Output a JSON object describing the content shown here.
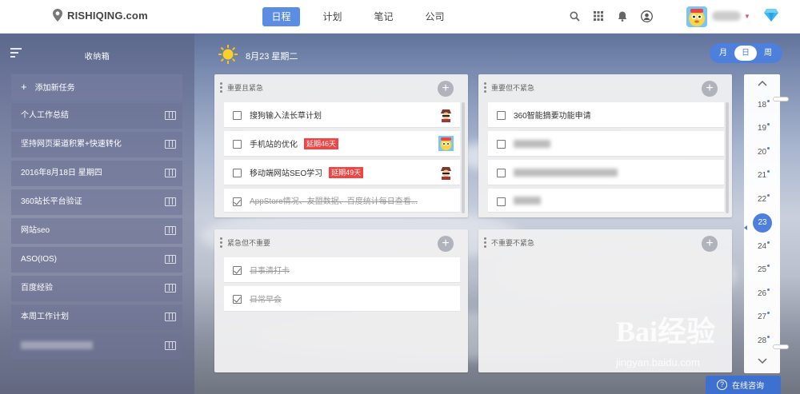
{
  "logo": {
    "text": "RISHIQING.com"
  },
  "nav": [
    {
      "label": "日程",
      "active": true
    },
    {
      "label": "计划",
      "active": false
    },
    {
      "label": "笔记",
      "active": false
    },
    {
      "label": "公司",
      "active": false
    }
  ],
  "top_icons": [
    "search-icon",
    "grid-icon",
    "bell-icon",
    "user-circle-icon"
  ],
  "sidebar": {
    "title": "收纳箱",
    "add_label": "添加新任务",
    "items": [
      "个人工作总结",
      "坚持网页渠道积累+快速转化",
      "2016年8月18日 星期四",
      "360站长平台验证",
      "网站seo",
      "ASO(IOS)",
      "百度经验",
      "本周工作计划",
      ""
    ]
  },
  "date_header": {
    "label": "8月23 星期二"
  },
  "view_switch": [
    {
      "label": "月",
      "active": false
    },
    {
      "label": "日",
      "active": true
    },
    {
      "label": "周",
      "active": false
    }
  ],
  "quadrants": {
    "q1": {
      "title": "重要且紧急",
      "tasks": [
        {
          "text": "搜狗输入法长草计划",
          "badge": "",
          "done": false
        },
        {
          "text": "手机站的优化",
          "badge": "延期46天",
          "done": false
        },
        {
          "text": "移动端网站SEO学习",
          "badge": "延期49天",
          "done": false
        },
        {
          "text": "AppStore情况、友盟数据、百度统计每日查看...",
          "badge": "",
          "done": true
        }
      ]
    },
    "q2": {
      "title": "重要但不紧急",
      "tasks": [
        {
          "text": "360智能摘要功能申请",
          "done": false
        }
      ]
    },
    "q3": {
      "title": "紧急但不重要",
      "tasks": [
        {
          "text": "日事清打卡",
          "done": true
        },
        {
          "text": "日常早会",
          "done": true
        }
      ]
    },
    "q4": {
      "title": "不重要不紧急",
      "tasks": []
    }
  },
  "days": {
    "up": "^",
    "down": "v",
    "list": [
      "18",
      "19",
      "20",
      "21",
      "22",
      "23",
      "24",
      "25",
      "26",
      "27",
      "28"
    ],
    "today": "23"
  },
  "watermark": {
    "main": "Bai经验",
    "sub": "jingyan.baidu.com"
  },
  "consult": {
    "label": "在线咨询"
  },
  "colors": {
    "accent": "#4d7fdc",
    "badge": "#ef4545"
  }
}
